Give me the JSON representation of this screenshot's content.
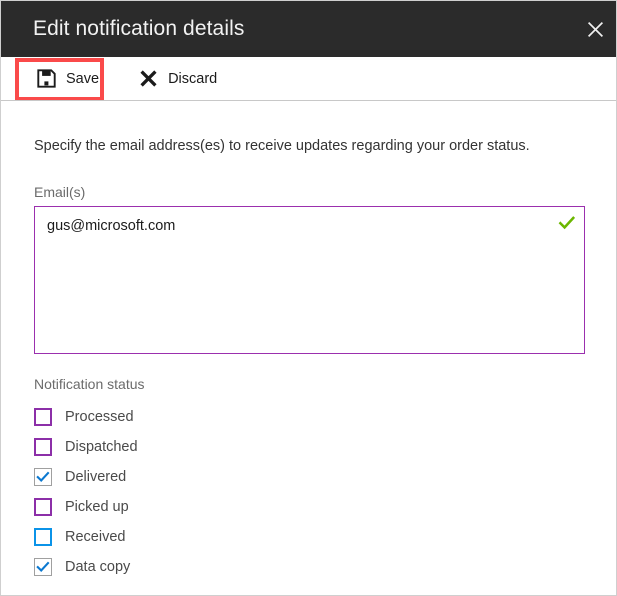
{
  "window": {
    "title": "Edit notification details",
    "close_icon": "close-icon"
  },
  "toolbar": {
    "save_label": "Save",
    "save_icon": "save-floppy-icon",
    "discard_label": "Discard",
    "discard_icon": "x-cross-icon",
    "highlight_color": "#fa4a4a",
    "highlighted_item": "Save"
  },
  "form": {
    "description": "Specify the email address(es) to receive updates regarding your order status.",
    "emails": {
      "label": "Email(s)",
      "value": "gus@microsoft.com",
      "placeholder": "",
      "border_color": "#9b2fae",
      "validation_icon": "green-check-icon",
      "validation_color": "#6bb700"
    },
    "status": {
      "label": "Notification status",
      "items": [
        {
          "label": "Processed",
          "checked": false,
          "outline": "purple"
        },
        {
          "label": "Dispatched",
          "checked": false,
          "outline": "purple"
        },
        {
          "label": "Delivered",
          "checked": true,
          "outline": "gray"
        },
        {
          "label": "Picked up",
          "checked": false,
          "outline": "purple"
        },
        {
          "label": "Received",
          "checked": false,
          "outline": "blue"
        },
        {
          "label": "Data copy",
          "checked": true,
          "outline": "gray"
        }
      ]
    }
  },
  "colors": {
    "titlebar_bg": "#2b2b2b",
    "title_text": "#f2f2f2",
    "accent_purple": "#8c2fa8",
    "accent_blue": "#0b93e8",
    "check_blue": "#0b78d0",
    "check_green": "#6bb700"
  }
}
